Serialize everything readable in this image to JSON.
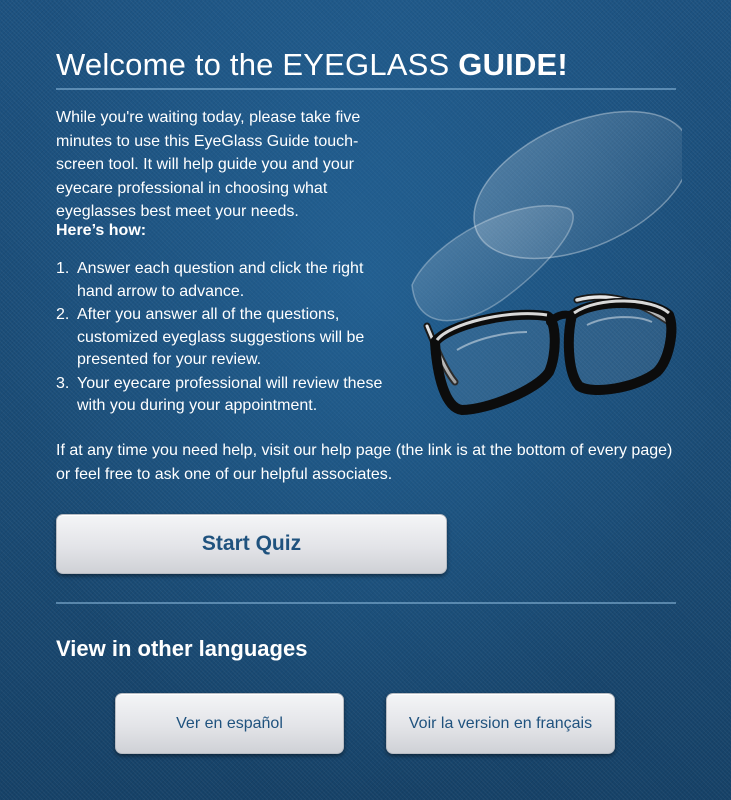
{
  "header": {
    "title_prefix": "Welcome to the EYEGLASS ",
    "title_bold": "GUIDE!"
  },
  "intro": {
    "text": "While you're waiting today, please take five minutes to use this EyeGlass Guide touch-screen tool. It will help guide you and your eyecare professional in choosing what eyeglasses best meet your needs."
  },
  "howto": {
    "heading": "Here’s how:",
    "steps": [
      {
        "num": "1.",
        "text": "Answer each question and click the right hand arrow to advance."
      },
      {
        "num": "2.",
        "text": "After you answer all of the questions, customized eyeglass suggestions will be presented for your review."
      },
      {
        "num": "3.",
        "text": "Your eyecare professional will review these with you during your appointment."
      }
    ]
  },
  "help": {
    "text": "If at any time you need help, visit our help page (the link is at the bottom of every page) or feel free to ask one of our helpful associates."
  },
  "actions": {
    "start_label": "Start Quiz"
  },
  "languages": {
    "heading": "View in other languages",
    "spanish_label": "Ver en español",
    "french_label": "Voir la version en français"
  },
  "image": {
    "icon": "eyeglasses-illustration"
  },
  "colors": {
    "background": "#1b4d78",
    "button_text": "#1f527e",
    "button_face": "#e3e4e8"
  }
}
